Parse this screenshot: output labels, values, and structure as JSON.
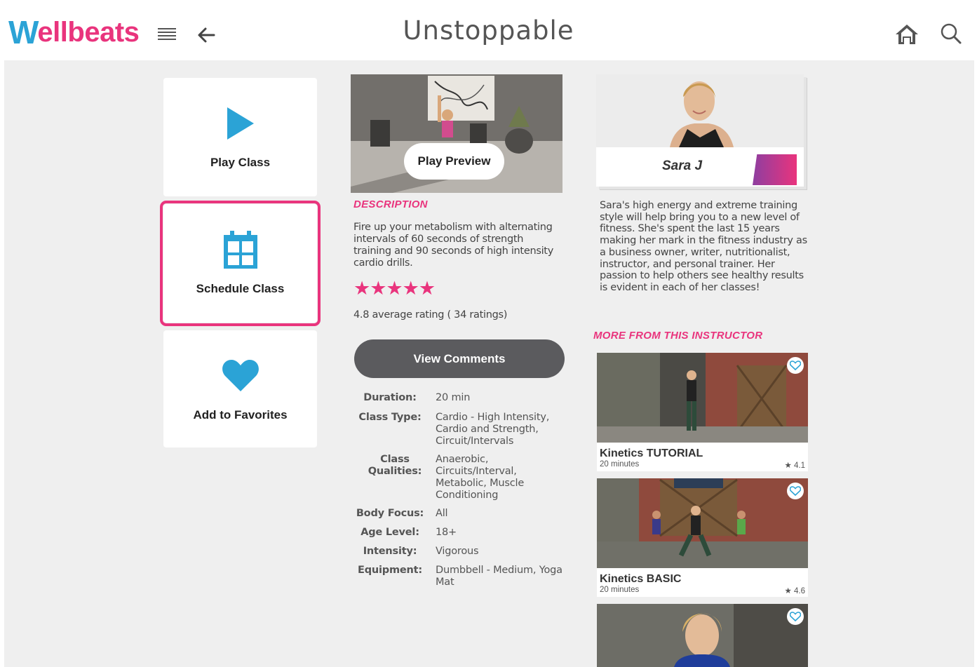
{
  "header": {
    "logo_first": "W",
    "logo_rest": "ellbeats",
    "title": "Unstoppable"
  },
  "actions": {
    "play_label": "Play Class",
    "schedule_label": "Schedule Class",
    "favorites_label": "Add to Favorites"
  },
  "class": {
    "preview_label": "Play Preview",
    "description_heading": "DESCRIPTION",
    "description": "Fire up your metabolism with alternating intervals of 60 seconds of strength training and 90 seconds of high intensity cardio drills.",
    "stars": "★★★★★",
    "rating_text": "4.8 average rating ( 34 ratings)",
    "rating_value": 4.8,
    "comments_label": "View Comments",
    "details": [
      {
        "key": "Duration:",
        "value": "20 min"
      },
      {
        "key": "Class Type:",
        "value": "Cardio - High Intensity, Cardio and Strength, Circuit/Intervals"
      },
      {
        "key": "Class Qualities:",
        "value": "Anaerobic, Circuits/Interval, Metabolic, Muscle Conditioning"
      },
      {
        "key": "Body Focus:",
        "value": "All"
      },
      {
        "key": "Age Level:",
        "value": "18+"
      },
      {
        "key": "Intensity:",
        "value": "Vigorous"
      },
      {
        "key": "Equipment:",
        "value": "Dumbbell - Medium, Yoga Mat"
      }
    ]
  },
  "instructor": {
    "name": "Sara J",
    "bio": "Sara's high energy and extreme training style will help bring you to a new level of fitness. She's spent the last 15 years making her mark in the fitness industry as a business owner, writer, nutritionalist, instructor, and personal trainer. Her passion to help others see healthy results is evident in each of her classes!",
    "more_heading": "MORE FROM THIS INSTRUCTOR",
    "videos": [
      {
        "title": "Kinetics TUTORIAL",
        "duration": "20 minutes",
        "rating": "★ 4.1"
      },
      {
        "title": "Kinetics BASIC",
        "duration": "20 minutes",
        "rating": "★ 4.6"
      },
      {
        "title": "",
        "duration": "",
        "rating": ""
      }
    ]
  },
  "colors": {
    "brand_pink": "#e9347d",
    "brand_blue": "#2ba3d6",
    "button_dark": "#5b5b5e",
    "background": "#efefef"
  },
  "icons": [
    "menu-icon",
    "back-arrow-icon",
    "home-icon",
    "search-icon",
    "play-icon",
    "calendar-icon",
    "heart-icon",
    "star-icon",
    "heart-outline-icon"
  ]
}
